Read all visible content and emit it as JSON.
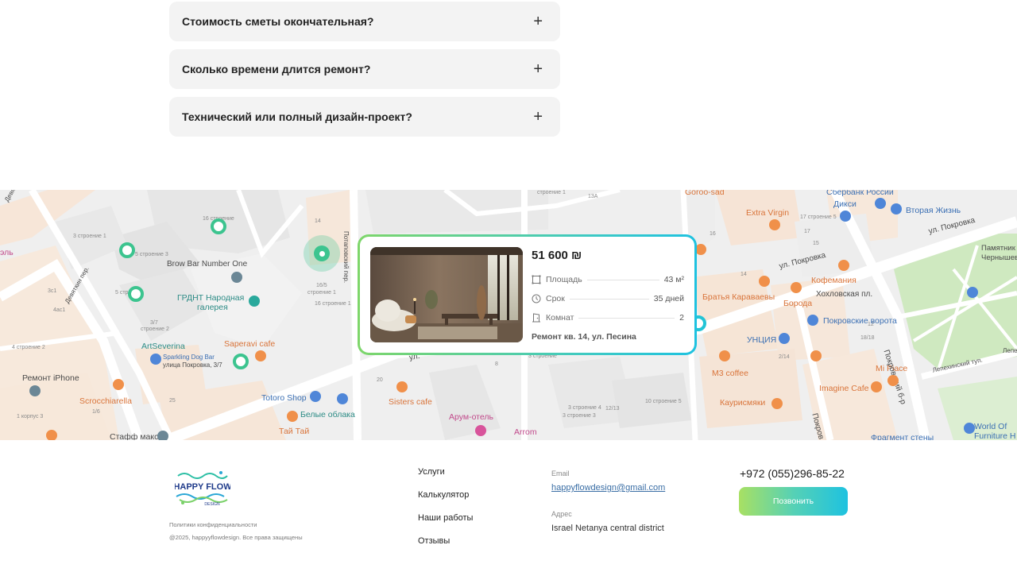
{
  "faq": {
    "items": [
      {
        "question": "Стоимость сметы окончательная?",
        "icon": "+"
      },
      {
        "question": "Сколько времени длится ремонт?",
        "icon": "+"
      },
      {
        "question": "Технический или полный дизайн-проект?",
        "icon": "+"
      }
    ]
  },
  "map": {
    "labels": {
      "brow_bar": "Brow Bar Number One",
      "grdnt": "ГРДНТ Народная",
      "grdnt2": "галерея",
      "artseverina": "ArtSeverina",
      "sparkling": "Sparkling Dog Bar",
      "sparkling_addr": "улица Покровка, 3/7",
      "saperavi": "Saperavi cafe",
      "remont_iphone": "Ремонт iPhone",
      "scrocchiarella": "Scrocchiarella",
      "totoro": "Totoro Shop",
      "belye": "Белые облака",
      "tai": "Тай Тай",
      "sisters": "Sisters cafe",
      "arum": "Арум-отель",
      "arrom": "Arrom",
      "shtafmaks": "Стафф макс",
      "extra_virgin": "Extra Virgin",
      "sberbank": "Сбербанк России",
      "diksi": "Дикси",
      "vtoraya": "Вторая Жизнь",
      "pokrovka1": "ул. Покровка",
      "pokrovka2": "ул. Покровка",
      "kofemania": "Кофемания",
      "bratya": "Братья Караваевы",
      "boroda": "Борода",
      "khokhlovskaya": "Хохловская пл.",
      "pokrovskie": "Покровские ворота",
      "unciya": "УНЦИЯ",
      "m3": "M3 coffee",
      "kaurismyaki": "Каурисмяки",
      "mi_piace": "Mi Piace",
      "imagine": "Imagine Cafe",
      "pokrovsky_bul": "Покровский б-р",
      "pamyatnik": "Памятник Н.Г.",
      "chernyshevskomu": "Чернышевском",
      "lepekhinsky": "Лепехинский туп.",
      "world_of": "World Of",
      "furniture": "Furniture H",
      "fragment": "Фрагмент стены",
      "potapovsky": "Потаповский пер.",
      "devyatkin1": "Девяткин пер.",
      "devyatkin2": "Девяткин пер.",
      "gorod_sad": "Goroo-sad",
      "korpus": "1 корпус 3",
      "el": "эль",
      "ul": "ул.",
      "pokrov": "Покров",
      "lepe": "Лепе"
    },
    "numbers": {
      "n16s": "16 строение",
      "n3s1": "3 строение 1",
      "n5s3": "5 строение 3",
      "n14": "14",
      "n165": "16/5",
      "n165s": "строение 1",
      "n16s1": "16 строение 1",
      "n5s": "5 стр",
      "n3c1": "3с1",
      "n4ac1": "4ас1",
      "n37": "3/7",
      "n37s": "строение 2",
      "n4s2": "4 строение 2",
      "n16": "16",
      "n25": "25",
      "n20": "20",
      "n8": "8",
      "n16b": "1/6",
      "n13a": "13А",
      "ns1": "строение 1",
      "n17s": "17 строение 5",
      "n17": "17",
      "n16m": "16",
      "n15": "15",
      "n12": "12",
      "n14b": "14",
      "n18": "18/18",
      "n214": "2/14",
      "n1213": "12/13",
      "n10s": "10 строение 5",
      "n3s4": "3 строение 4",
      "n3s3": "3 строение 3",
      "n3s": "3 строение",
      "n2": "2"
    }
  },
  "card": {
    "price": "51 600 ₪",
    "rows": [
      {
        "icon": "area-icon",
        "label": "Площадь",
        "value": "43 м²"
      },
      {
        "icon": "clock-icon",
        "label": "Срок",
        "value": "35 дней"
      },
      {
        "icon": "door-icon",
        "label": "Комнат",
        "value": "2"
      }
    ],
    "address": "Ремонт кв. 14, ул. Песина"
  },
  "footer": {
    "logo_text": "HAPPY FLOW",
    "logo_sub": "DESIGN",
    "privacy": "Политики конфиденциальности",
    "copyright": "@2025, happyyflowdesign. Все права защищены",
    "nav": [
      "Услуги",
      "Калькулятор",
      "Наши работы",
      "Отзывы"
    ],
    "email_label": "Email",
    "email": "happyflowdesign@gmail.com",
    "address_label": "Адрес",
    "address": "Israel Netanya central district",
    "phone": "+972 (055)296-85-22",
    "call_button": "Позвонить"
  },
  "colors": {
    "accent_green": "#3cc48f",
    "accent_cyan": "#1ec2e0",
    "faq_bg": "#f3f3f3"
  }
}
